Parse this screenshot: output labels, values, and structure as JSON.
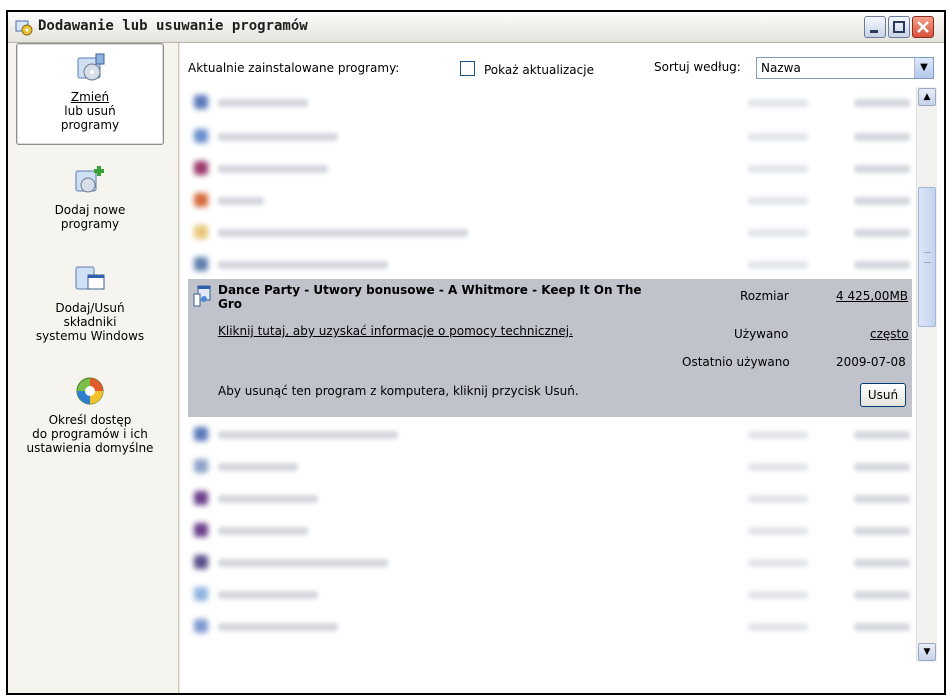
{
  "window": {
    "title": "Dodawanie lub usuwanie programów",
    "buttons": [
      "minimize",
      "maximize",
      "close"
    ]
  },
  "sidebar": {
    "items": [
      {
        "label_line1": "Zmień",
        "label_line2": "lub usuń",
        "label_line3": "programy",
        "icon": "change-remove-programs-icon",
        "active": true
      },
      {
        "label_line1": "Dodaj nowe",
        "label_line2": "programy",
        "icon": "add-programs-icon",
        "active": false
      },
      {
        "label_line1": "Dodaj/Usuń",
        "label_line2": "składniki",
        "label_line3": "systemu Windows",
        "icon": "windows-components-icon",
        "active": false
      },
      {
        "label_line1": "Określ dostęp",
        "label_line2": "do programów i ich",
        "label_line3": "ustawienia domyślne",
        "icon": "program-access-icon",
        "active": false
      }
    ]
  },
  "toolbar": {
    "installed_label": "Aktualnie zainstalowane programy:",
    "show_updates_label": "Pokaż aktualizacje",
    "show_updates_checked": false,
    "sort_label": "Sortuj według:",
    "sort_value": "Nazwa"
  },
  "selected_program": {
    "name": "Dance Party - Utwory bonusowe - A Whitmore - Keep It On The Gro",
    "size_label": "Rozmiar",
    "size_value": "4 425,00MB",
    "support_link": "Kliknij tutaj, aby uzyskać informacje o pomocy technicznej.",
    "used_label": "Używano",
    "used_value": "często",
    "last_used_label": "Ostatnio używano",
    "last_used_value": "2009-07-08",
    "remove_hint": "Aby usunąć ten program z komputera, kliknij przycisk Usuń.",
    "remove_button": "Usuń"
  },
  "colors": {
    "selected_row": "#c0c3cb",
    "window_bg": "#ece9d8",
    "sidebar_bg": "#f5f4ee"
  }
}
